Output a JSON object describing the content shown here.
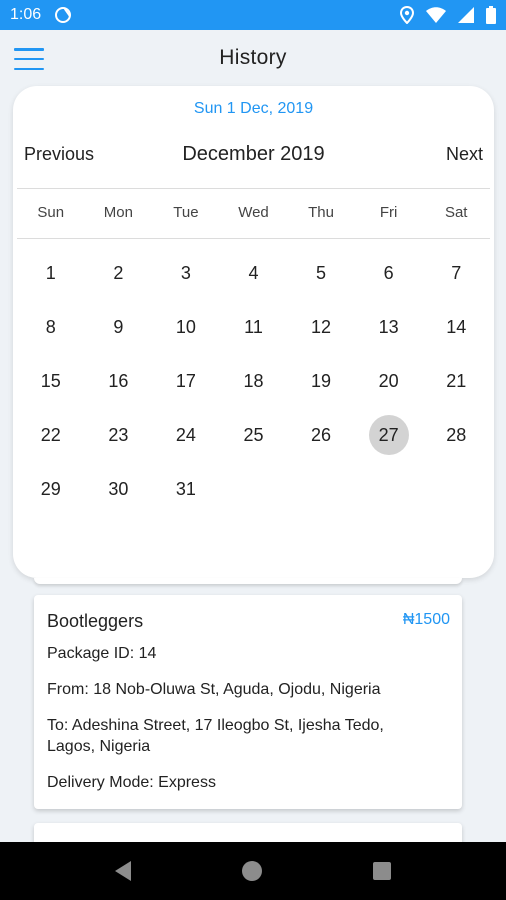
{
  "status_bar": {
    "time": "1:06"
  },
  "app_bar": {
    "title": "History"
  },
  "calendar": {
    "selected_date_label": "Sun 1 Dec, 2019",
    "previous_label": "Previous",
    "next_label": "Next",
    "month_title": "December 2019",
    "weekdays": [
      "Sun",
      "Mon",
      "Tue",
      "Wed",
      "Thu",
      "Fri",
      "Sat"
    ],
    "days": [
      "1",
      "2",
      "3",
      "4",
      "5",
      "6",
      "7",
      "8",
      "9",
      "10",
      "11",
      "12",
      "13",
      "14",
      "15",
      "16",
      "17",
      "18",
      "19",
      "20",
      "21",
      "22",
      "23",
      "24",
      "25",
      "26",
      "27",
      "28",
      "29",
      "30",
      "31"
    ],
    "highlighted_day": "27"
  },
  "order": {
    "name": "Bootleggers",
    "price": "₦1500",
    "package_id": "Package ID: 14",
    "from": "From: 18 Nob-Oluwa St, Aguda, Ojodu, Nigeria",
    "to": "To: Adeshina Street, 17 Ileogbo St, Ijesha Tedo, Lagos, Nigeria",
    "delivery_mode": "Delivery Mode: Express"
  },
  "icons": {
    "sync": "sync-icon",
    "location": "location-icon",
    "wifi": "wifi-icon",
    "signal": "signal-icon",
    "battery": "battery-icon",
    "menu": "menu-icon",
    "back": "back-icon",
    "home": "home-icon",
    "recents": "recents-icon"
  },
  "colors": {
    "accent": "#2196f3",
    "selected_day": "#d3d3d3"
  }
}
